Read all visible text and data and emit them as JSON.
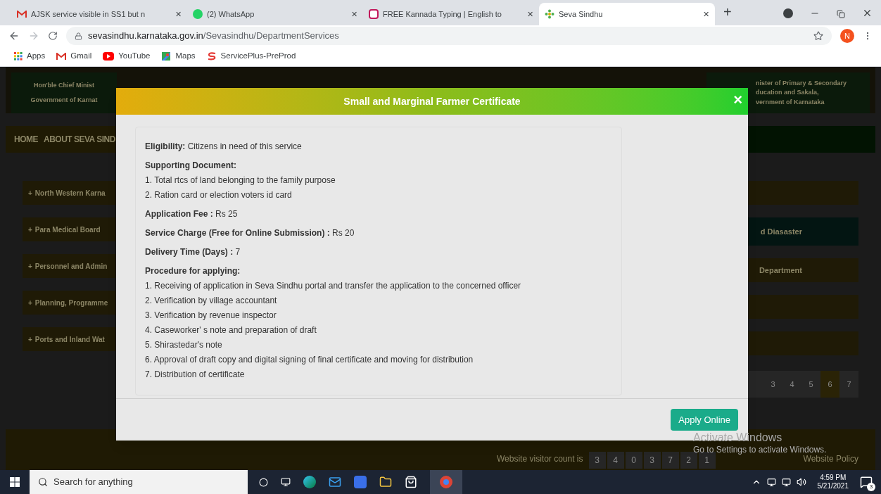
{
  "browser": {
    "tabs": [
      {
        "title": "AJSK service visible in SS1 but n",
        "selected": false
      },
      {
        "title": "(2) WhatsApp",
        "selected": false
      },
      {
        "title": "FREE Kannada Typing | English to",
        "selected": false
      },
      {
        "title": "Seva Sindhu",
        "selected": true
      }
    ],
    "close_glyph": "✕",
    "new_tab": "+",
    "url_host": "sevasindhu.karnataka.gov.in",
    "url_path": "/Sevasindhu/DepartmentServices",
    "profile": "N",
    "bookmarks": [
      "Apps",
      "Gmail",
      "YouTube",
      "Maps",
      "ServicePlus-PreProd"
    ]
  },
  "page": {
    "header_left": [
      "Hon'ble Chief Minist",
      "Government of Karnat"
    ],
    "header_right": [
      "nister of Primary & Secondary",
      "ducation and Sakala,",
      "vernment of Karnataka"
    ],
    "nav": [
      "HOME",
      "ABOUT SEVA SIND"
    ],
    "expand_glyph": "+",
    "left_departments": [
      "North Western Karna",
      "Para Medical Board",
      "Personnel and Admin",
      "Planning, Programme",
      "Ports and Inland Wat"
    ],
    "right_departments": [
      {
        "selected": false
      },
      {
        "text": "d Diasaster",
        "selected": true
      },
      {
        "text": "Department",
        "selected": false
      },
      {
        "selected": false
      },
      {
        "selected": false
      }
    ],
    "pages": [
      {
        "label": "3",
        "selected": false
      },
      {
        "label": "4",
        "selected": false
      },
      {
        "label": "5",
        "selected": false
      },
      {
        "label": "6",
        "selected": true
      },
      {
        "label": "7",
        "selected": false
      }
    ],
    "visitor_label": "Website visitor count is",
    "visitor_digits": [
      "3",
      "4",
      "0",
      "3",
      "7",
      "2",
      "1"
    ],
    "policy_link": "Website Policy"
  },
  "modal": {
    "title": "Small and Marginal Farmer Certificate",
    "close": "×",
    "sections": [
      {
        "kind": "line",
        "text": "**Eligibility:** Citizens in need of this service"
      },
      {
        "kind": "list",
        "heading": "Supporting Document:",
        "items": [
          "1. Total rtcs of land belonging to the family purpose",
          "2. Ration card or election voters id card"
        ]
      },
      {
        "kind": "line",
        "text": "**Application Fee :** Rs 25"
      },
      {
        "kind": "line",
        "text": "**Service Charge (Free for Online Submission) :** Rs 20"
      },
      {
        "kind": "line",
        "text": "**Delivery Time (Days) :** 7"
      },
      {
        "kind": "list",
        "heading": "Procedure for applying:",
        "items": [
          "1. Receiving of application in Seva Sindhu portal and transfer the application to the concerned officer",
          "2. Verification by village accountant",
          "3. Verification by revenue inspector",
          "4. Caseworker' s note and preparation of draft",
          "5. Shirastedar's note",
          "6. Approval of draft copy and digital signing of final certificate and moving for distribution",
          "7. Distribution of certificate"
        ]
      }
    ],
    "apply_button": "Apply Online"
  },
  "activation": {
    "title": "Activate Windows",
    "subtitle": "Go to Settings to activate Windows."
  },
  "taskbar": {
    "search_placeholder": "Search for anything",
    "time": "4:59 PM",
    "date": "5/21/2021",
    "notifications": "3"
  }
}
